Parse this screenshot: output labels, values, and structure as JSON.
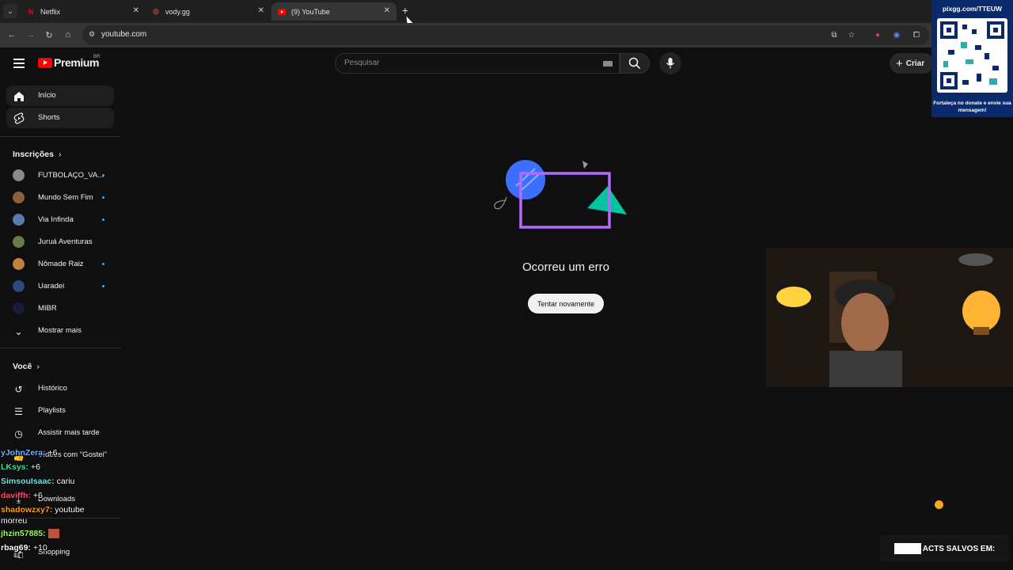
{
  "browser": {
    "tabs": [
      {
        "title": "Netflix",
        "favicon_color": "#e50914",
        "active": false
      },
      {
        "title": "vody.gg",
        "favicon_color": "#e53935",
        "active": false
      },
      {
        "title": "(9) YouTube",
        "favicon_color": "#ff0000",
        "active": true
      }
    ],
    "url": "youtube.com"
  },
  "youtube": {
    "logo_text": "Premium",
    "logo_region": "BR",
    "search_placeholder": "Pesquisar",
    "create_label": "Criar",
    "sidebar": {
      "main": [
        {
          "label": "Início",
          "icon": "home-icon"
        },
        {
          "label": "Shorts",
          "icon": "shorts-icon"
        }
      ],
      "subscriptions_title": "Inscrições",
      "subscriptions": [
        {
          "label": "FUTBOLAÇO_VA...",
          "new": true,
          "color": "#8a8a8a"
        },
        {
          "label": "Mundo Sem Fim",
          "new": true,
          "color": "#8b5e3c"
        },
        {
          "label": "Via Infinda",
          "new": true,
          "color": "#5a7ab0"
        },
        {
          "label": "Juruá Aventuras",
          "new": false,
          "color": "#6a7a4a"
        },
        {
          "label": "Nômade Raiz",
          "new": true,
          "color": "#c08040"
        },
        {
          "label": "Uaradei",
          "new": true,
          "color": "#2a4a7a"
        },
        {
          "label": "MIBR",
          "new": false,
          "color": "#1a1a3a"
        }
      ],
      "show_more": "Mostrar mais",
      "you_title": "Você",
      "you": [
        {
          "label": "Histórico",
          "icon": "history-icon"
        },
        {
          "label": "Playlists",
          "icon": "playlists-icon"
        },
        {
          "label": "Assistir mais tarde",
          "icon": "watch-later-icon"
        },
        {
          "label": "Vídeos com \"Gostei\"",
          "icon": "like-icon"
        },
        {
          "label": "Downloads",
          "icon": "download-icon"
        },
        {
          "label": "Shopping",
          "icon": "shopping-icon"
        }
      ]
    },
    "error": {
      "title": "Ocorreu um erro",
      "retry": "Tentar novamente"
    }
  },
  "overlay": {
    "qr_url": "pixgg.com/TTEUW",
    "qr_caption": "Fortaleça no donate e envie sua mensagem!",
    "promo_text": "ACTS SALVOS EM:",
    "chat": [
      {
        "user": "yJohnZera:",
        "msg": " +6",
        "color": "#6fb7ff"
      },
      {
        "user": "LKsys:",
        "msg": " +6",
        "color": "#3fe0a0"
      },
      {
        "user": "SimsouIsaac:",
        "msg": " cariu",
        "color": "#7fe0e0"
      },
      {
        "user": "daviffh:",
        "msg": " +6",
        "color": "#ff4f6f"
      },
      {
        "user": "shadowzxy7:",
        "msg": " youtube",
        "color": "#ff9f1a"
      },
      {
        "user": "",
        "msg": "morreu",
        "color": "#ffffff"
      },
      {
        "user": "jhzin57885:",
        "msg": "",
        "color": "#9fff5f"
      },
      {
        "user": "rbag69:",
        "msg": " +10",
        "color": "#ffffff"
      }
    ]
  }
}
